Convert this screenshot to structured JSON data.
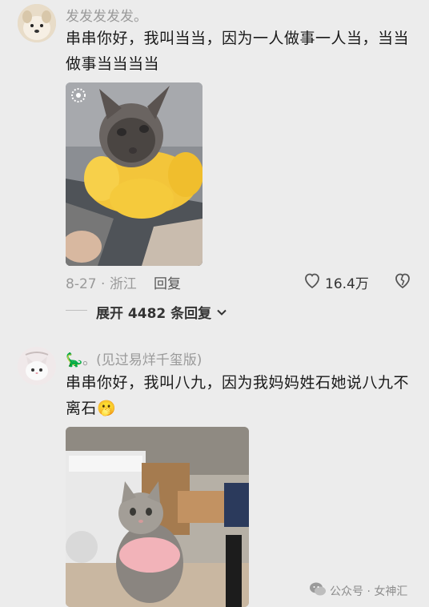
{
  "comments": [
    {
      "username": "发发发发发。",
      "text": "串串你好，我叫当当，因为一人做事一人当，当当做事当当当当",
      "date": "8-27",
      "location": "浙江",
      "reply_label": "回复",
      "likes": "16.4万",
      "expand_label": "展开 4482 条回复",
      "photo_alt": "Himalayan cat wearing yellow pumpkin collar"
    },
    {
      "username": "。(见过易烊千玺版)",
      "username_prefix": "🦕",
      "text": "串串你好，我叫八九，因为我妈妈姓石她说八九不离石",
      "emoji": "🫢",
      "photo_alt": "grey tabby cat wearing pink sweater"
    }
  ],
  "watermark": {
    "label": "公众号 · 女神汇"
  },
  "colors": {
    "background": "#ececec",
    "meta_gray": "#9a9a9a",
    "pumpkin_yellow": "#f3c53a"
  }
}
